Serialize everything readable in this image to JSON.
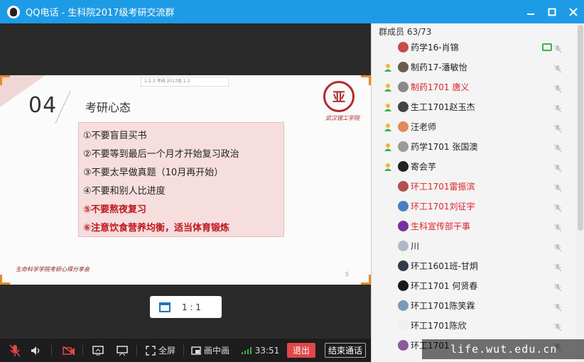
{
  "window": {
    "title": "QQ电话 - 生科院2017级考研交流群"
  },
  "slide": {
    "number": "04",
    "heading": "考研心态",
    "topbar_text": "1-2-3 考研 2017级 1 2",
    "items": [
      {
        "text": "①不要盲目买书",
        "highlight": false
      },
      {
        "text": "②不要等到最后一个月才开始复习政治",
        "highlight": false
      },
      {
        "text": "③不要太早做真题（10月再开始）",
        "highlight": false
      },
      {
        "text": "④不要和别人比进度",
        "highlight": false
      },
      {
        "text": "⑤不要熬夜复习",
        "highlight": true
      },
      {
        "text": "⑥注意饮食营养均衡，适当体育锻炼",
        "highlight": true
      }
    ],
    "footer": "生命科学学院考研心得分享会",
    "page_number": "5",
    "seal_signature": "武汉理工学院"
  },
  "ratio": {
    "label": "1 : 1"
  },
  "toolbar": {
    "fullscreen_label": "全屏",
    "pip_label": "画中画",
    "duration": "33:51",
    "exit_label": "退出",
    "end_call_label": "结束通话"
  },
  "members": {
    "header": "群成员 63/73",
    "list": [
      {
        "name": "药学16-肖锦",
        "red": false,
        "host": false,
        "sharing": true,
        "avatar_color": "#c94a4a"
      },
      {
        "name": "制药17-潘敏怡",
        "red": false,
        "host": true,
        "sharing": false,
        "avatar_color": "#6b5a4a"
      },
      {
        "name": "制药1701   唐义",
        "red": true,
        "host": true,
        "sharing": false,
        "avatar_color": "#8a8a8a"
      },
      {
        "name": "生工1701赵玉杰",
        "red": false,
        "host": true,
        "sharing": false,
        "avatar_color": "#444444"
      },
      {
        "name": "汪老师",
        "red": false,
        "host": true,
        "sharing": false,
        "avatar_color": "#e28a5a"
      },
      {
        "name": "药学1701 张国澳",
        "red": false,
        "host": true,
        "sharing": false,
        "avatar_color": "#9a9a9a"
      },
      {
        "name": "寄会芋",
        "red": false,
        "host": true,
        "sharing": false,
        "avatar_color": "#222222"
      },
      {
        "name": "环工1701雷振滨",
        "red": true,
        "host": false,
        "sharing": false,
        "avatar_color": "#b05050"
      },
      {
        "name": "环工1701刘征宇",
        "red": true,
        "host": false,
        "sharing": false,
        "avatar_color": "#4a7fbf"
      },
      {
        "name": "生科宣传部干事",
        "red": true,
        "host": false,
        "sharing": false,
        "avatar_color": "#7a2fa0"
      },
      {
        "name": "川",
        "red": false,
        "host": false,
        "sharing": false,
        "avatar_color": "#b0b8c8"
      },
      {
        "name": "环工1601班-甘炯",
        "red": false,
        "host": false,
        "sharing": false,
        "avatar_color": "#333a4a"
      },
      {
        "name": "环工1701 何贤春",
        "red": false,
        "host": false,
        "sharing": false,
        "avatar_color": "#1a1a1a"
      },
      {
        "name": "环工1701陈笑霖",
        "red": false,
        "host": false,
        "sharing": false,
        "avatar_color": "#7a9ab5"
      },
      {
        "name": "环工1701陈欣",
        "red": false,
        "host": false,
        "sharing": false,
        "avatar_color": "#f0f0f0"
      },
      {
        "name": "环工1701",
        "red": false,
        "host": false,
        "sharing": false,
        "avatar_color": "#8a5a9a"
      }
    ]
  },
  "watermark": "life.wut.edu.cn",
  "colors": {
    "titlebar": "#1e9be6",
    "exit": "#e04848",
    "red_name": "#e0232a",
    "mic_muted": "#c0c0c0"
  }
}
